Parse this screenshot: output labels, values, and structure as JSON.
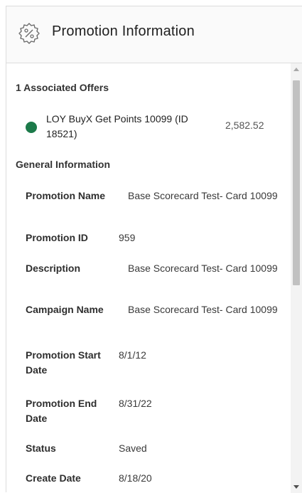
{
  "header": {
    "title": "Promotion Information",
    "icon": "percent-badge-icon"
  },
  "offers": {
    "section_title": "1 Associated Offers",
    "items": [
      {
        "name": "LOY BuyX Get Points 10099 (ID 18521)",
        "value": "2,582.52",
        "status_color": "#1c7a4a"
      }
    ]
  },
  "general": {
    "section_title": "General Information",
    "rows": [
      {
        "label": "Promotion Name",
        "value": "Base Scorecard Test- Card 10099"
      },
      {
        "label": "Promotion ID",
        "value": "959"
      },
      {
        "label": "Description",
        "value": "Base Scorecard Test- Card 10099"
      },
      {
        "label": "Campaign Name",
        "value": "Base Scorecard Test- Card 10099"
      },
      {
        "label": "Promotion Start Date",
        "value": "8/1/12"
      },
      {
        "label": "Promotion End Date",
        "value": "8/31/22"
      },
      {
        "label": "Status",
        "value": "Saved"
      },
      {
        "label": "Create Date",
        "value": "8/18/20"
      }
    ]
  }
}
